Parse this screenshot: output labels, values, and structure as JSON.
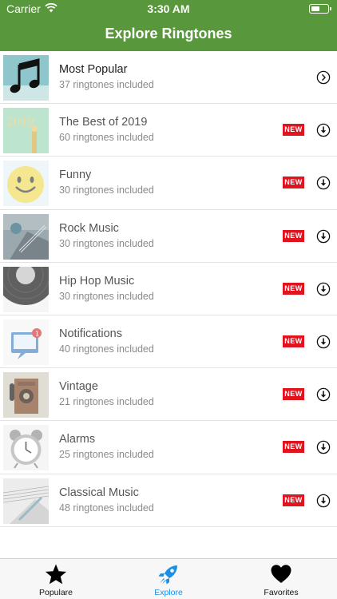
{
  "status_bar": {
    "carrier": "Carrier",
    "time": "3:30 AM"
  },
  "header": {
    "title": "Explore Ringtones"
  },
  "colors": {
    "header_green": "#58973b",
    "new_badge_red": "#e0141e",
    "active_tab_blue": "#1a8fe6"
  },
  "categories": [
    {
      "title": "Most Popular",
      "subtitle": "37 ringtones included",
      "thumbnail": "music-note-icon",
      "action": "chevron-right-icon"
    },
    {
      "title": "The Best of 2019",
      "subtitle": "60 ringtones included",
      "badge": "NEW",
      "thumbnail": "2019-balloons",
      "action": "download-icon"
    },
    {
      "title": "Funny",
      "subtitle": "30 ringtones included",
      "badge": "NEW",
      "thumbnail": "smiley-face",
      "action": "download-icon"
    },
    {
      "title": "Rock Music",
      "subtitle": "30 ringtones included",
      "badge": "NEW",
      "thumbnail": "guitar",
      "action": "download-icon"
    },
    {
      "title": "Hip Hop Music",
      "subtitle": "30 ringtones included",
      "badge": "NEW",
      "thumbnail": "vinyl-record",
      "action": "download-icon"
    },
    {
      "title": "Notifications",
      "subtitle": "40 ringtones included",
      "badge": "NEW",
      "thumbnail": "notification-bubble",
      "action": "download-icon"
    },
    {
      "title": "Vintage",
      "subtitle": "21 ringtones included",
      "badge": "NEW",
      "thumbnail": "vintage-phone",
      "action": "download-icon"
    },
    {
      "title": "Alarms",
      "subtitle": "25 ringtones included",
      "badge": "NEW",
      "thumbnail": "alarm-clock",
      "action": "download-icon"
    },
    {
      "title": "Classical Music",
      "subtitle": "48 ringtones included",
      "badge": "NEW",
      "thumbnail": "sheet-music",
      "action": "download-icon"
    }
  ],
  "tabbar": {
    "tabs": [
      {
        "label": "Populare",
        "icon": "star-icon",
        "active": false
      },
      {
        "label": "Explore",
        "icon": "rocket-icon",
        "active": true
      },
      {
        "label": "Favorites",
        "icon": "heart-icon",
        "active": false
      }
    ]
  }
}
